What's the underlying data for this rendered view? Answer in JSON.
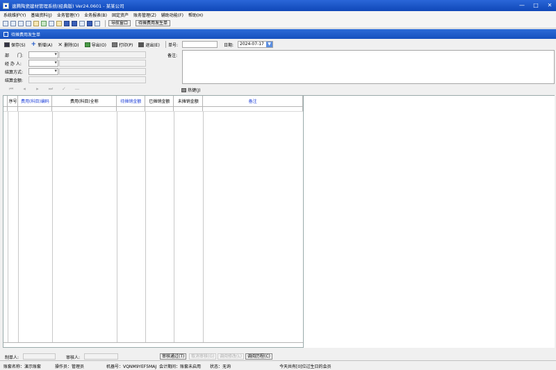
{
  "window": {
    "title": "速腾陶瓷建材管理系统(经典版) Ver24.0601  -  某某公司",
    "minimize": "—",
    "maximize": "□",
    "close": "✕"
  },
  "menu": [
    "系统维护(Y)",
    "基础资料(J)",
    "业务管理(Y)",
    "业务报表(B)",
    "固定资产",
    "账务管理(Z)",
    "辅助功能(F)",
    "帮助(H)"
  ],
  "toolbar": {
    "tabs": [
      "导航窗口",
      "待摊费用发生单"
    ]
  },
  "document": {
    "title": "待摊费用发生单"
  },
  "actions": {
    "save": "保存(S)",
    "add": "新增(A)",
    "delete": "删除(D)",
    "export": "导出(O)",
    "print": "打印(P)",
    "exit": "退出(E)"
  },
  "form": {
    "doc_no_label": "单号:",
    "doc_no_value": "",
    "date_label": "日期:",
    "date_value": "2024-07-17",
    "dept_label": "部　　门:",
    "handler_label": "经 办 人:",
    "settle_method_label": "结算方式:",
    "settle_amount_label": "结算金额:",
    "remark_label": "备注:"
  },
  "nav": {
    "hotkey": "热键(J)"
  },
  "grid": {
    "columns": [
      {
        "label": "序号",
        "blue": false
      },
      {
        "label": "费用(科目)编码",
        "blue": true
      },
      {
        "label": "费用(科目)全称",
        "blue": false
      },
      {
        "label": "待摊销金额",
        "blue": true
      },
      {
        "label": "已摊销金额",
        "blue": false
      },
      {
        "label": "未摊销金额",
        "blue": false
      },
      {
        "label": "备注",
        "blue": true
      }
    ]
  },
  "bottom": {
    "creator_label": "制单人:",
    "reviewer_label": "审核人:",
    "btn_approve": "审核通过(T)",
    "btn_unapprove": "取消审核(G)",
    "btn_modify": "调阅修改(L)",
    "btn_history": "调阅历程(C)"
  },
  "status": {
    "account": "账套名称：演示账套",
    "operator": "操作员：管理员",
    "machine": "机器号：VQNM9YEF5MAJ",
    "period": "会计期间：账套未启用",
    "state": "状态：无询",
    "birthday": "今天共有[0]位过生日的会员"
  }
}
